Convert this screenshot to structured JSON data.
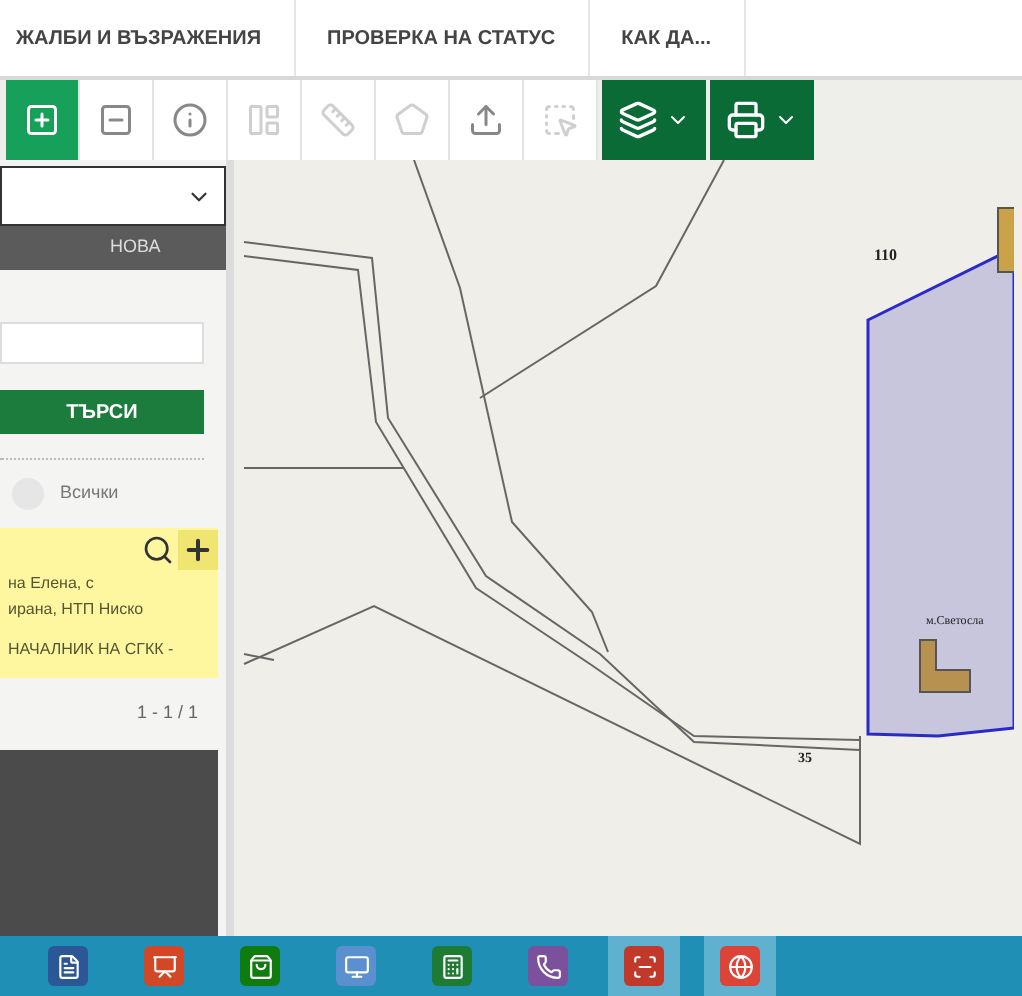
{
  "nav": {
    "tabs": [
      {
        "label": "ЖАЛБИ И ВЪЗРАЖЕНИЯ"
      },
      {
        "label": "ПРОВЕРКА НА СТАТУС"
      },
      {
        "label": "КАК ДА..."
      }
    ]
  },
  "toolbar": {
    "tools": [
      {
        "kind": "tool",
        "selected": true,
        "disabled": false
      },
      {
        "kind": "tool",
        "selected": false,
        "disabled": false
      },
      {
        "kind": "tool",
        "selected": false,
        "disabled": false
      },
      {
        "kind": "tool",
        "selected": false,
        "disabled": true
      },
      {
        "kind": "tool",
        "selected": false,
        "disabled": true
      },
      {
        "kind": "tool",
        "selected": false,
        "disabled": true
      },
      {
        "kind": "tool",
        "selected": false,
        "disabled": false
      },
      {
        "kind": "tool",
        "selected": false,
        "disabled": true
      },
      {
        "kind": "menu",
        "selected": false,
        "disabled": false
      },
      {
        "kind": "menu",
        "selected": false,
        "disabled": false
      }
    ]
  },
  "sidebar": {
    "tab_label": "НОВА",
    "search_button": "ТЪРСИ",
    "filter": {
      "label": "Всички",
      "checked": false
    },
    "result": {
      "lines": [
        "на Елена, с",
        "ирана, НТП Ниско",
        "НАЧАЛНИК НА СГКК -"
      ]
    },
    "pagination": "1 - 1 / 1"
  },
  "map": {
    "labels": [
      "110",
      "35",
      "м.Светосла"
    ]
  },
  "taskbar": {
    "apps": [
      {
        "selected": false
      },
      {
        "selected": false
      },
      {
        "selected": false
      },
      {
        "selected": false
      },
      {
        "selected": false
      },
      {
        "selected": false
      },
      {
        "selected": true
      },
      {
        "selected": true
      }
    ]
  }
}
